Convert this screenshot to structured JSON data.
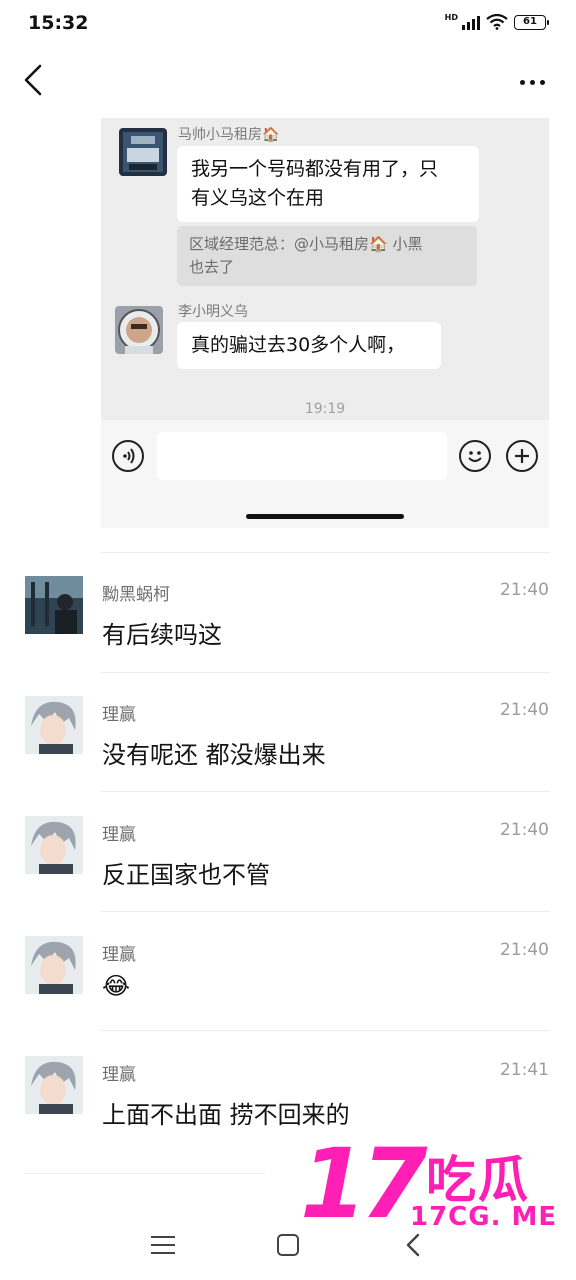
{
  "status_bar": {
    "time": "15:32",
    "network": "HD",
    "battery": "61"
  },
  "nav": {
    "back_icon": "chevron-left-icon",
    "more_icon": "more-horizontal-icon"
  },
  "embedded_chat": {
    "messages": [
      {
        "sender": "马帅小马租房🏠",
        "text_lines": [
          "我另一个号码都没有用了，只",
          "有义乌这个在用"
        ],
        "quote_lines": [
          "区域经理范总：@小马租房🏠 小黑",
          "也去了"
        ]
      },
      {
        "sender": "李小明义乌",
        "text_lines": [
          "真的骗过去30多个人啊，"
        ]
      }
    ],
    "timestamp": "19:19",
    "input_bar": {
      "voice_icon": "voice-icon",
      "emoji_icon": "emoji-icon",
      "plus_icon": "plus-icon"
    }
  },
  "comments": [
    {
      "name": "黝黑蜗柯",
      "time": "21:40",
      "text": "有后续吗这"
    },
    {
      "name": "理赢",
      "time": "21:40",
      "text": "没有呢还 都没爆出来"
    },
    {
      "name": "理赢",
      "time": "21:40",
      "text": "反正国家也不管"
    },
    {
      "name": "理赢",
      "time": "21:40",
      "text": "😂"
    },
    {
      "name": "理赢",
      "time": "21:41",
      "text": "上面不出面 捞不回来的"
    }
  ],
  "bottom_nav": {
    "menu_icon": "menu-icon",
    "home_icon": "home-square-icon",
    "back_icon": "back-chevron-icon"
  },
  "watermark": {
    "number": "17",
    "chinese": "吃瓜",
    "url": "17CG. ME",
    "color": "#ff1fb4"
  }
}
